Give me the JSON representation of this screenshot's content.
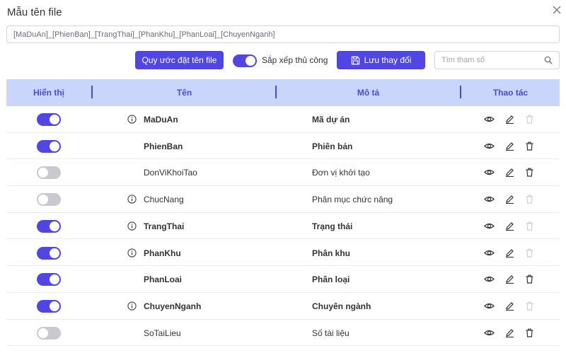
{
  "dialog": {
    "title": "Mẫu tên file",
    "pattern": "[MaDuAn]_[PhienBan]_[TrangThai]_[PhanKhu]_[PhanLoai]_[ChuyenNganh]"
  },
  "toolbar": {
    "naming_rule_label": "Quy ước đặt tên file",
    "manual_sort_label": "Sắp xếp thủ công",
    "manual_sort_on": true,
    "save_label": "Lưu thay đổi",
    "search_placeholder": "Tìm tham số"
  },
  "table": {
    "headers": {
      "visible": "Hiển thị",
      "name": "Tên",
      "description": "Mô tả",
      "actions": "Thao tác"
    },
    "rows": [
      {
        "visible": true,
        "info": true,
        "name": "MaDuAn",
        "description": "Mã dự án",
        "bold": true,
        "delete_enabled": false
      },
      {
        "visible": true,
        "info": false,
        "name": "PhienBan",
        "description": "Phiên bản",
        "bold": true,
        "delete_enabled": true
      },
      {
        "visible": false,
        "info": false,
        "name": "DonViKhoiTao",
        "description": "Đơn vị khởi tạo",
        "bold": false,
        "delete_enabled": true
      },
      {
        "visible": false,
        "info": true,
        "name": "ChucNang",
        "description": "Phân mục chức năng",
        "bold": false,
        "delete_enabled": false
      },
      {
        "visible": true,
        "info": true,
        "name": "TrangThai",
        "description": "Trạng thái",
        "bold": true,
        "delete_enabled": false
      },
      {
        "visible": true,
        "info": true,
        "name": "PhanKhu",
        "description": "Phân khu",
        "bold": true,
        "delete_enabled": false
      },
      {
        "visible": true,
        "info": false,
        "name": "PhanLoai",
        "description": "Phân loại",
        "bold": true,
        "delete_enabled": true
      },
      {
        "visible": true,
        "info": true,
        "name": "ChuyenNganh",
        "description": "Chuyên ngành",
        "bold": true,
        "delete_enabled": false
      },
      {
        "visible": false,
        "info": false,
        "name": "SoTaiLieu",
        "description": "Số tài liệu",
        "bold": false,
        "delete_enabled": true
      }
    ]
  },
  "icons": {
    "close": "close-icon",
    "search": "search-icon",
    "save": "floppy-disk-icon",
    "info": "info-circle-icon",
    "view": "eye-icon",
    "edit": "pencil-icon",
    "delete": "trash-icon"
  },
  "colors": {
    "accent": "#4f46e5",
    "header_bg": "#c9d5fb",
    "toggle_off": "#c9c9cf",
    "icon": "#333333",
    "icon_disabled": "#cfcfd6"
  }
}
